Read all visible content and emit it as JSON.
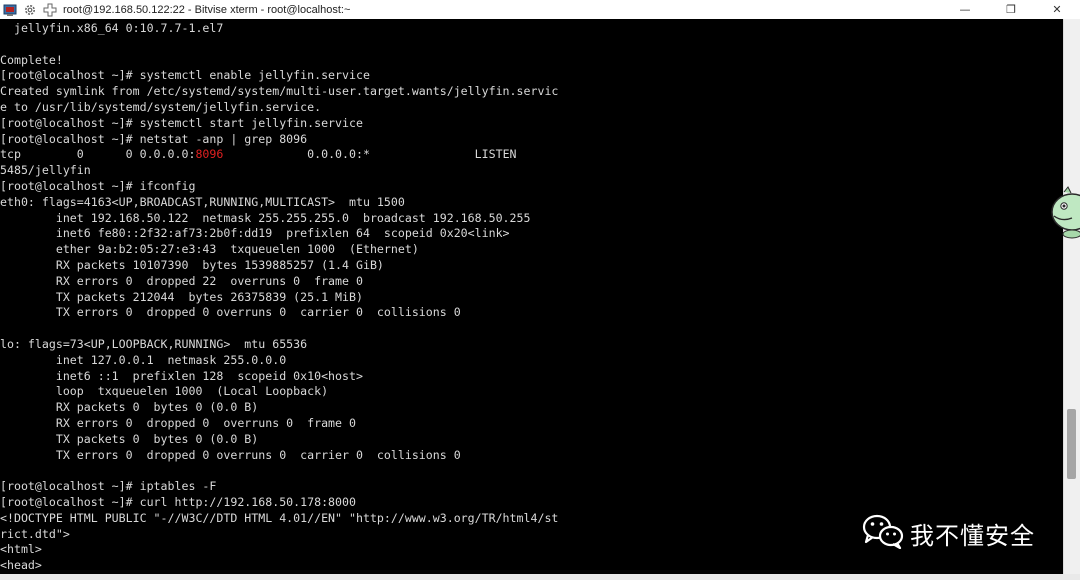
{
  "window": {
    "title": "root@192.168.50.122:22 - Bitvise xterm - root@localhost:~",
    "controls": {
      "minimize": "—",
      "restore": "❐",
      "close": "✕"
    }
  },
  "titlebar_icons": [
    "putty-icon",
    "gear-icon",
    "plus-icon"
  ],
  "terminal": {
    "lines": [
      {
        "text": "  jellyfin.x86_64 0:10.7.7-1.el7"
      },
      {
        "text": ""
      },
      {
        "text": "Complete!"
      },
      {
        "text": "[root@localhost ~]# systemctl enable jellyfin.service"
      },
      {
        "text": "Created symlink from /etc/systemd/system/multi-user.target.wants/jellyfin.servic"
      },
      {
        "text": "e to /usr/lib/systemd/system/jellyfin.service."
      },
      {
        "text": "[root@localhost ~]# systemctl start jellyfin.service"
      },
      {
        "text": "[root@localhost ~]# netstat -anp | grep 8096"
      },
      {
        "pre": "tcp        0      0 0.0.0.0:",
        "highlight": "8096",
        "post": "            0.0.0.0:*               LISTEN"
      },
      {
        "text": "5485/jellyfin"
      },
      {
        "text": "[root@localhost ~]# ifconfig"
      },
      {
        "text": "eth0: flags=4163<UP,BROADCAST,RUNNING,MULTICAST>  mtu 1500"
      },
      {
        "text": "        inet 192.168.50.122  netmask 255.255.255.0  broadcast 192.168.50.255"
      },
      {
        "text": "        inet6 fe80::2f32:af73:2b0f:dd19  prefixlen 64  scopeid 0x20<link>"
      },
      {
        "text": "        ether 9a:b2:05:27:e3:43  txqueuelen 1000  (Ethernet)"
      },
      {
        "text": "        RX packets 10107390  bytes 1539885257 (1.4 GiB)"
      },
      {
        "text": "        RX errors 0  dropped 22  overruns 0  frame 0"
      },
      {
        "text": "        TX packets 212044  bytes 26375839 (25.1 MiB)"
      },
      {
        "text": "        TX errors 0  dropped 0 overruns 0  carrier 0  collisions 0"
      },
      {
        "text": ""
      },
      {
        "text": "lo: flags=73<UP,LOOPBACK,RUNNING>  mtu 65536"
      },
      {
        "text": "        inet 127.0.0.1  netmask 255.0.0.0"
      },
      {
        "text": "        inet6 ::1  prefixlen 128  scopeid 0x10<host>"
      },
      {
        "text": "        loop  txqueuelen 1000  (Local Loopback)"
      },
      {
        "text": "        RX packets 0  bytes 0 (0.0 B)"
      },
      {
        "text": "        RX errors 0  dropped 0  overruns 0  frame 0"
      },
      {
        "text": "        TX packets 0  bytes 0 (0.0 B)"
      },
      {
        "text": "        TX errors 0  dropped 0 overruns 0  carrier 0  collisions 0"
      },
      {
        "text": ""
      },
      {
        "text": "[root@localhost ~]# iptables -F"
      },
      {
        "text": "[root@localhost ~]# curl http://192.168.50.178:8000"
      },
      {
        "text": "<!DOCTYPE HTML PUBLIC \"-//W3C//DTD HTML 4.01//EN\" \"http://www.w3.org/TR/html4/st"
      },
      {
        "text": "rict.dtd\">"
      },
      {
        "text": "<html>"
      },
      {
        "text": "<head>"
      }
    ],
    "foreground_color": "#d9d9d9",
    "background_color": "#000000",
    "highlight_color": "#e02020"
  },
  "watermark": {
    "text": "我不懂安全",
    "icon": "wechat-icon"
  },
  "mascot": {
    "icon": "dinosaur-mascot-icon"
  }
}
